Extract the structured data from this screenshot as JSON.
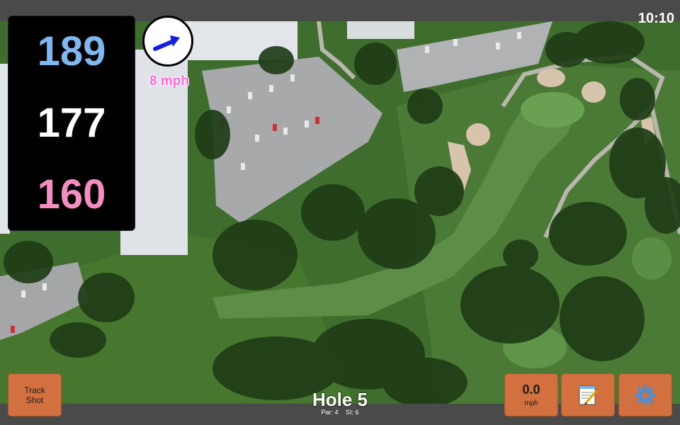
{
  "status": {
    "clock": "10:10"
  },
  "distances": {
    "back": "189",
    "middle": "177",
    "front": "160"
  },
  "wind": {
    "speed_label": "8 mph",
    "icon": "wind-direction-arrow-icon",
    "arrow_color": "#1020e0"
  },
  "buttons": {
    "track_shot": {
      "line1": "Track",
      "line2": "Shot"
    },
    "speed": {
      "value": "0.0",
      "unit": "mph"
    },
    "notes": {
      "icon": "notepad-icon"
    },
    "settings": {
      "icon": "gear-icon"
    }
  },
  "hole": {
    "title": "Hole 5",
    "par": "Par: 4",
    "si": "SI: 6"
  },
  "colors": {
    "button": "#d2703f",
    "back": "#7fb8f0",
    "middle": "#ffffff",
    "front": "#f48ec1",
    "wind_text": "#ff66d8"
  }
}
